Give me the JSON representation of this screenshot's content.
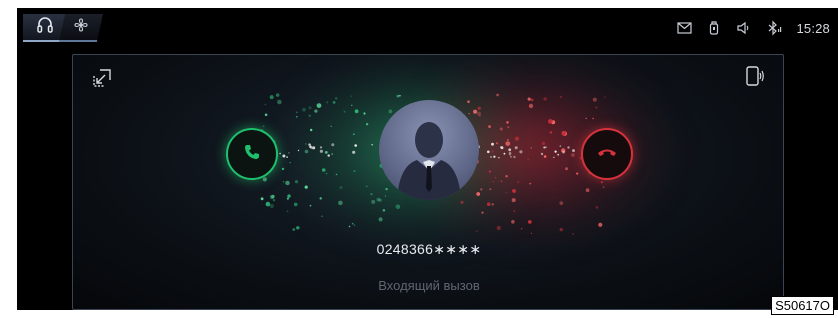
{
  "status_bar": {
    "tabs": [
      {
        "icon": "headset-icon",
        "active": true
      },
      {
        "icon": "fan-icon",
        "active": false
      }
    ],
    "icons": [
      "mail-icon",
      "key-fob-icon",
      "speaker-icon",
      "bluetooth-icon"
    ],
    "time": "15:28"
  },
  "call": {
    "number": "0248366∗∗∗∗",
    "status": "Входящий вызов",
    "accept_icon": "phone-accept-icon",
    "decline_icon": "phone-decline-icon",
    "accept_color": "#1fbf6d",
    "decline_color": "#d5333c"
  },
  "panel": {
    "left_icon": "minimize-call-icon",
    "right_icon": "phone-device-icon"
  },
  "figure_code": "S50617O"
}
